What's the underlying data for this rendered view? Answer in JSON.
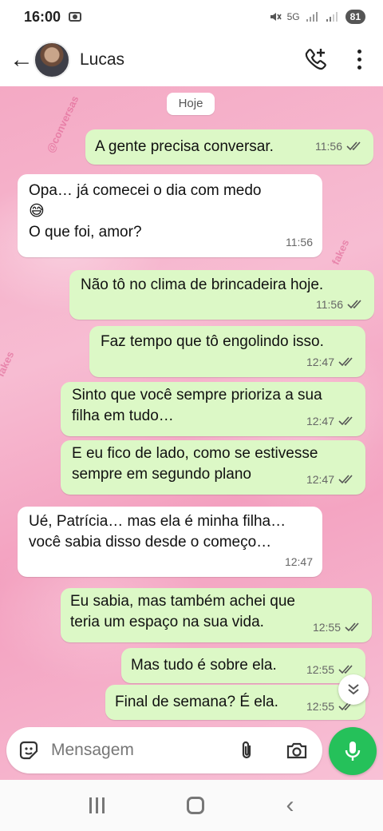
{
  "status_bar": {
    "time": "16:00",
    "network": "5G",
    "battery": "81"
  },
  "header": {
    "contact_name": "Lucas"
  },
  "chat": {
    "date_label": "Hoje",
    "messages": [
      {
        "direction": "out",
        "text": "A gente precisa conversar.",
        "time": "11:56",
        "status": "read"
      },
      {
        "direction": "in",
        "text": "Opa… já comecei o dia com medo\n😅\nO que foi, amor?",
        "time": "11:56"
      },
      {
        "direction": "out",
        "text": "Não tô no clima de brincadeira hoje.",
        "time": "11:56",
        "status": "read"
      },
      {
        "direction": "out",
        "text": "Faz tempo que tô engolindo isso.",
        "time": "12:47",
        "status": "read"
      },
      {
        "direction": "out",
        "text": "Sinto que você sempre prioriza a sua\nfilha em tudo…",
        "time": "12:47",
        "status": "read"
      },
      {
        "direction": "out",
        "text": "E eu fico de lado, como se estivesse\nsempre em segundo plano",
        "time": "12:47",
        "status": "read"
      },
      {
        "direction": "in",
        "text": "Ué, Patrícia… mas ela é minha filha…\nvocê sabia disso desde o começo…",
        "time": "12:47"
      },
      {
        "direction": "out",
        "text": "Eu sabia, mas também achei que\nteria um espaço na sua vida.",
        "time": "12:55",
        "status": "read"
      },
      {
        "direction": "out",
        "text": "Mas tudo é sobre ela.",
        "time": "12:55",
        "status": "read"
      },
      {
        "direction": "out",
        "text": "Final de semana? É ela.",
        "time": "12:55",
        "status": "read"
      }
    ]
  },
  "composer": {
    "placeholder": "Mensagem"
  },
  "icons": {
    "back": "arrow-left-icon",
    "call": "add-call-icon",
    "menu": "more-vert-icon",
    "sticker": "sticker-icon",
    "attach": "paperclip-icon",
    "camera": "camera-icon",
    "mic": "microphone-icon",
    "scroll": "double-chevron-down-icon"
  },
  "colors": {
    "outgoing_bubble": "#dcf8c6",
    "incoming_bubble": "#ffffff",
    "mic_button": "#25c15a",
    "wallpaper": "#f4a9c4"
  }
}
